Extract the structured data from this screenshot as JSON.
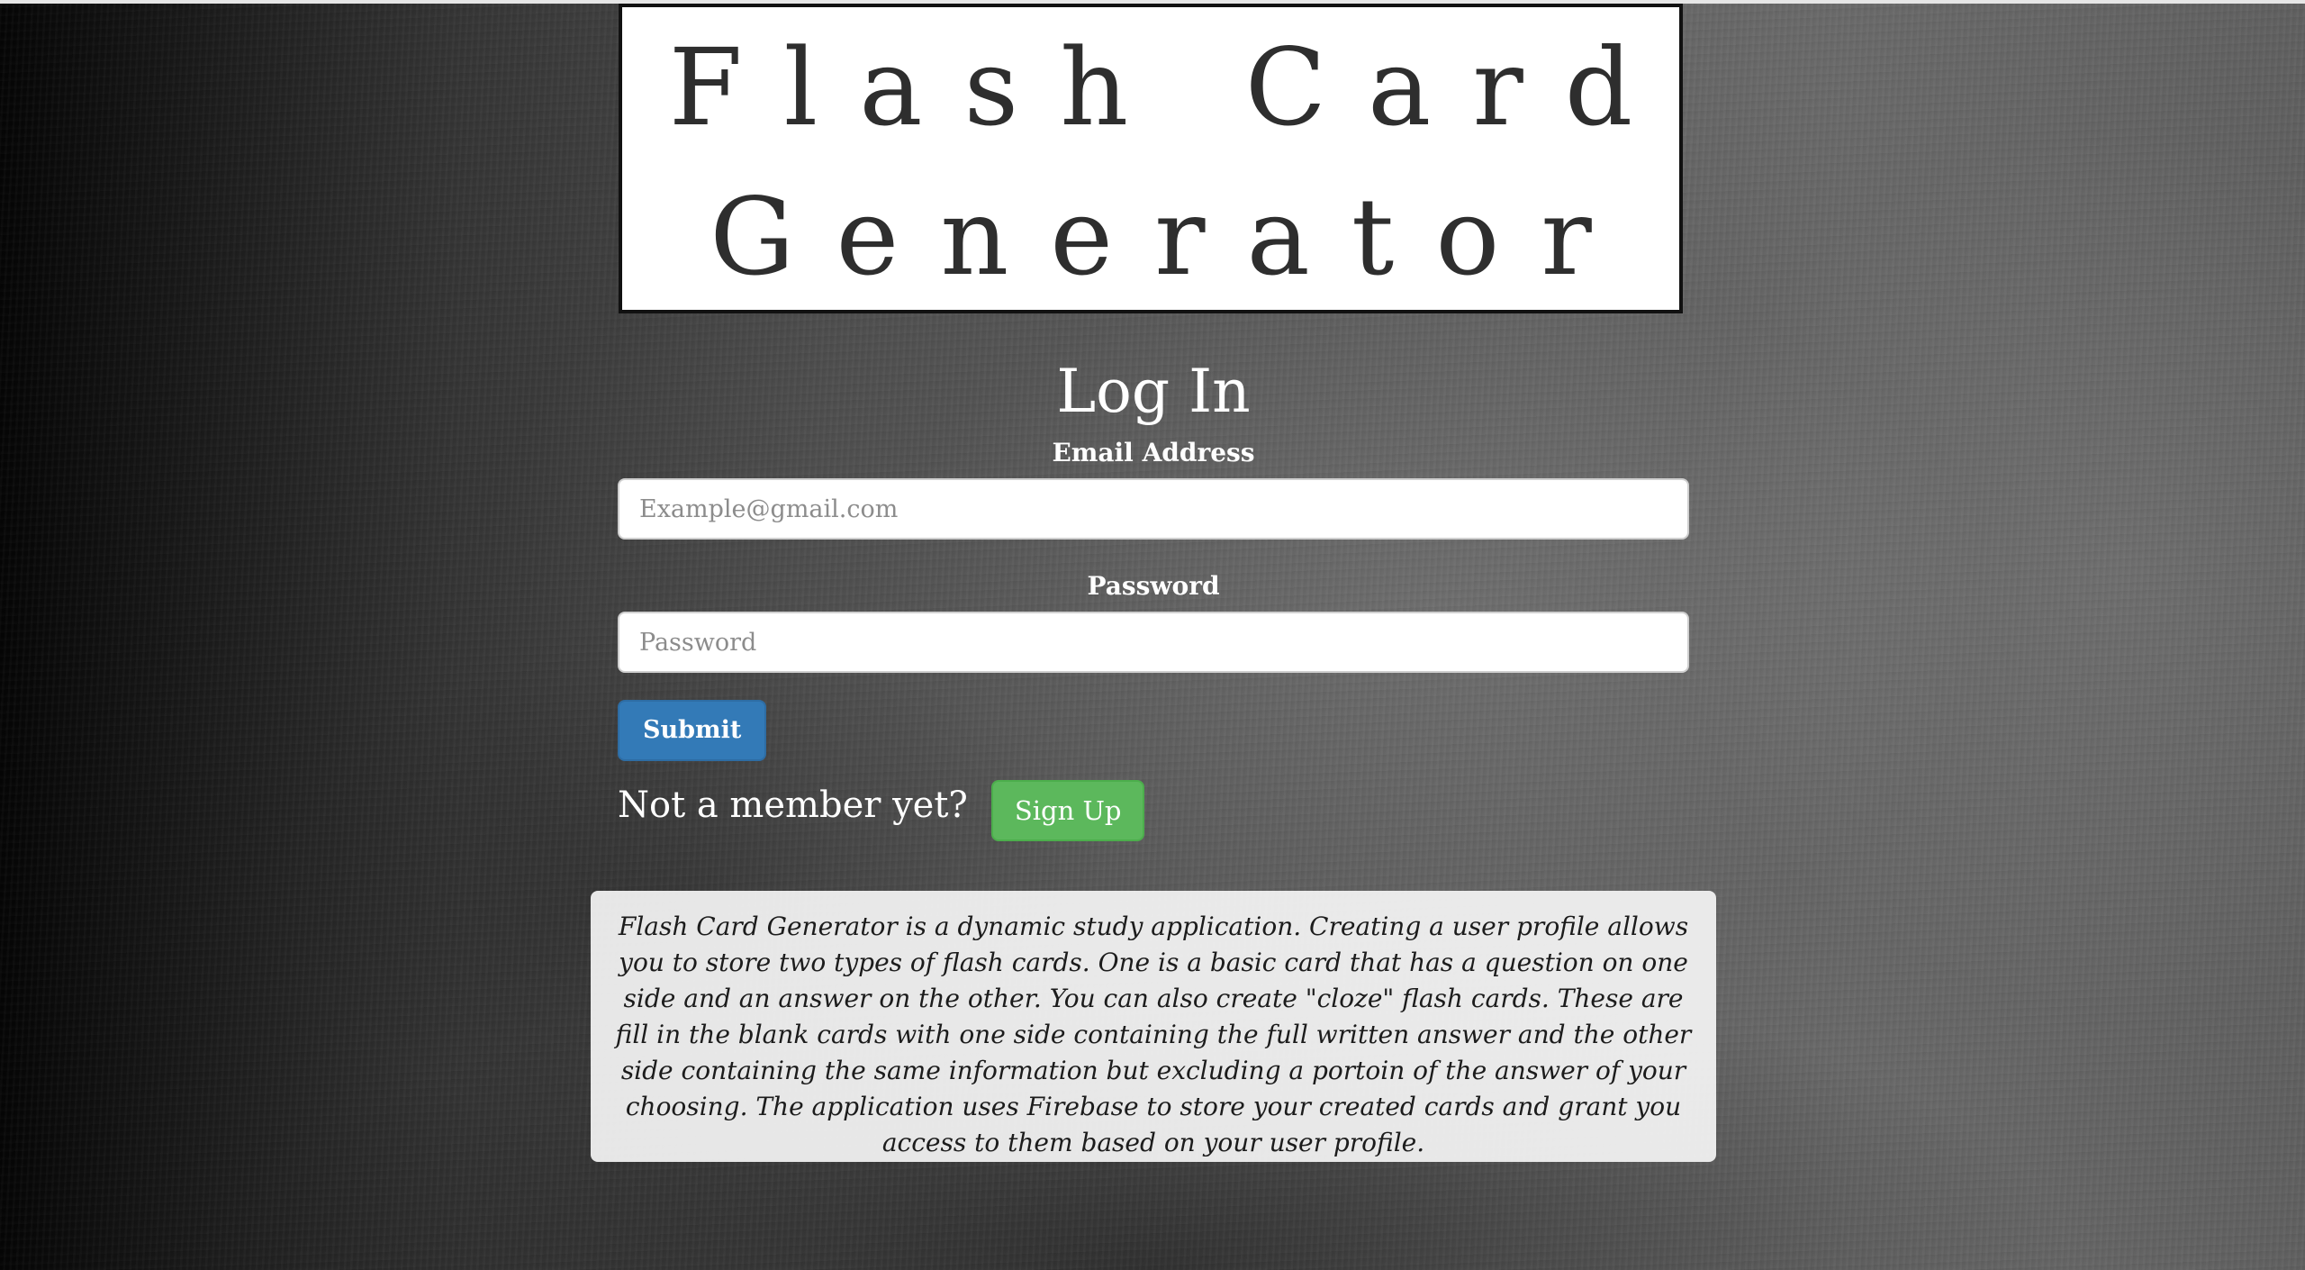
{
  "header": {
    "title_line_1": "Flash Card",
    "title_line_2": "Generator"
  },
  "login": {
    "heading": "Log In",
    "email_label": "Email Address",
    "email_placeholder": "Example@gmail.com",
    "password_label": "Password",
    "password_placeholder": "Password",
    "submit_label": "Submit"
  },
  "signup": {
    "prompt": "Not a member yet?",
    "button_label": "Sign Up"
  },
  "description": {
    "text": "Flash Card Generator is a dynamic study application. Creating a user profile allows you to store two types of flash cards. One is a basic card that has a question on one side and an answer on the other. You can also create \"cloze\" flash cards. These are fill in the blank cards with one side containing the full written answer and the other side containing the same information but excluding a portoin of the answer of your choosing. The application uses Firebase to store your created cards and grant you access to them based on your user profile."
  },
  "colors": {
    "submit_button": "#337ab7",
    "signup_button": "#5cb85c",
    "title_text": "#2e2e2e"
  }
}
